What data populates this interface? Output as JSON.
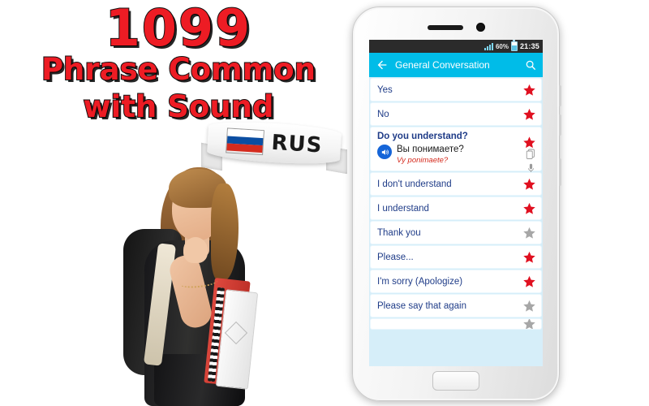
{
  "promo": {
    "count": "1099",
    "line2": "Phrase Common",
    "line3": "with Sound",
    "ribbon_label": "RUS",
    "accent_red": "#ED1C24",
    "flag_name": "russia-flag"
  },
  "phone": {
    "statusbar": {
      "signal_icon": "signal-bars-icon",
      "battery_percent": "60%",
      "battery_icon": "battery-icon",
      "clock": "21:35"
    },
    "appbar": {
      "back_icon": "back-arrow-icon",
      "title": "General Conversation",
      "search_icon": "search-icon",
      "background": "#00BCE8"
    },
    "list": {
      "star_on_color": "#E01020",
      "star_off_color": "#A7A7A7",
      "items": [
        {
          "en": "Yes",
          "starred": true
        },
        {
          "en": "No",
          "starred": true
        },
        {
          "en": "Do you understand?",
          "starred": true,
          "expanded": true,
          "native": "Вы понимаете?",
          "latin": "Vy ponimaete?",
          "speaker_icon": "speaker-icon",
          "copy_icon": "copy-icon",
          "mic_icon": "microphone-icon"
        },
        {
          "en": "I don't understand",
          "starred": true
        },
        {
          "en": "I understand",
          "starred": true
        },
        {
          "en": "Thank you",
          "starred": false
        },
        {
          "en": "Please...",
          "starred": true
        },
        {
          "en": "I'm sorry (Apologize)",
          "starred": true
        },
        {
          "en": "Please say that again",
          "starred": false
        }
      ]
    },
    "home_button": "home-button"
  }
}
